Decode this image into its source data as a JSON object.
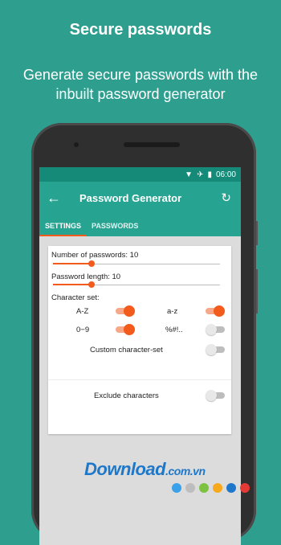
{
  "headline": "Secure passwords",
  "subline": "Generate secure passwords with the inbuilt password generator",
  "status": {
    "time": "06:00",
    "wifi_icon": "wifi-icon",
    "airplane_icon": "airplane-icon",
    "battery_icon": "battery-icon"
  },
  "appbar": {
    "title": "Password Generator",
    "back_icon": "arrow-back-icon",
    "refresh_icon": "refresh-icon"
  },
  "tabs": [
    {
      "label": "SETTINGS",
      "active": true
    },
    {
      "label": "PASSWORDS",
      "active": false
    }
  ],
  "settings": {
    "num_passwords_label": "Number of passwords: 10",
    "num_passwords_value": 10,
    "password_length_label": "Password length: 10",
    "password_length_value": 10,
    "charset_label": "Character set:",
    "charset": [
      {
        "label": "A-Z",
        "on": true
      },
      {
        "label": "a-z",
        "on": true
      },
      {
        "label": "0−9",
        "on": true
      },
      {
        "label": "%#!..",
        "on": false
      }
    ],
    "custom_charset_label": "Custom character-set",
    "custom_charset_on": false,
    "exclude_label": "Exclude characters",
    "exclude_on": false
  },
  "colors": {
    "background": "#2e9f8f",
    "primary": "#26a391",
    "accent": "#f25b1c"
  },
  "watermark": {
    "text": "Download",
    "suffix": ".com.vn",
    "dot_colors": [
      "#3aa0e8",
      "#bdbdbd",
      "#7dc242",
      "#f7a81b",
      "#1e77c8",
      "#e53935"
    ]
  }
}
